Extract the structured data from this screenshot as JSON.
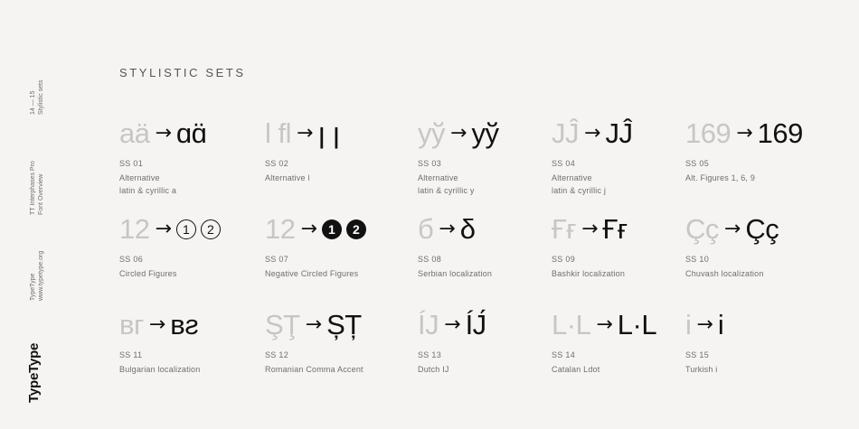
{
  "sidebar": {
    "pages": "14 — 15",
    "section": "Stylistic sets",
    "font_name": "TT Interphases Pro",
    "doc_title": "Font Overview",
    "company": "TypeType",
    "website": "www.typetype.org",
    "brand": "TypeType"
  },
  "heading": "STYLISTIC SETS",
  "sets": [
    {
      "code": "SS 01",
      "desc1": "Alternative",
      "desc2": "latin & cyrillic a",
      "before": "aä",
      "after": "ɑɑ̈"
    },
    {
      "code": "SS 02",
      "desc1": "Alternative l",
      "desc2": "",
      "before": "l fl",
      "after": "ꞁ ꞁ"
    },
    {
      "code": "SS 03",
      "desc1": "Alternative",
      "desc2": "latin & cyrillic y",
      "before": "yў",
      "after": "yў"
    },
    {
      "code": "SS 04",
      "desc1": "Alternative",
      "desc2": "latin & cyrillic j",
      "before": "JĴ",
      "after": "JĴ"
    },
    {
      "code": "SS 05",
      "desc1": "Alt. Figures 1, 6, 9",
      "desc2": "",
      "before": "169",
      "after": "169"
    },
    {
      "code": "SS 06",
      "desc1": "Circled Figures",
      "desc2": "",
      "before": "12",
      "after": [
        "1",
        "2"
      ]
    },
    {
      "code": "SS 07",
      "desc1": "Negative Circled Figures",
      "desc2": "",
      "before": "12",
      "after": [
        "1",
        "2"
      ]
    },
    {
      "code": "SS 08",
      "desc1": "Serbian localization",
      "desc2": "",
      "before": "б",
      "after": "δ"
    },
    {
      "code": "SS 09",
      "desc1": "Bashkir localization",
      "desc2": "",
      "before": "Ғғ",
      "after": "Ғғ"
    },
    {
      "code": "SS 10",
      "desc1": "Chuvash localization",
      "desc2": "",
      "before": "Çç",
      "after": "Çç"
    },
    {
      "code": "SS 11",
      "desc1": "Bulgarian localization",
      "desc2": "",
      "before": "вг",
      "after": "ʙƨ"
    },
    {
      "code": "SS 12",
      "desc1": "Romanian Comma Accent",
      "desc2": "",
      "before": "ŞŢ",
      "after": "ȘȚ"
    },
    {
      "code": "SS 13",
      "desc1": "Dutch IJ",
      "desc2": "",
      "before": "ÍJ",
      "after": "ÍJ́"
    },
    {
      "code": "SS 14",
      "desc1": "Catalan Ldot",
      "desc2": "",
      "before": "L·L",
      "after": "L·L"
    },
    {
      "code": "SS 15",
      "desc1": "Turkish i",
      "desc2": "",
      "before": "i",
      "after": "i"
    }
  ],
  "arrow_glyph": "→",
  "colors": {
    "background": "#f5f4f2",
    "before_glyph": "#c7c6c4",
    "after_glyph": "#111111",
    "label": "#6e6e6e"
  }
}
